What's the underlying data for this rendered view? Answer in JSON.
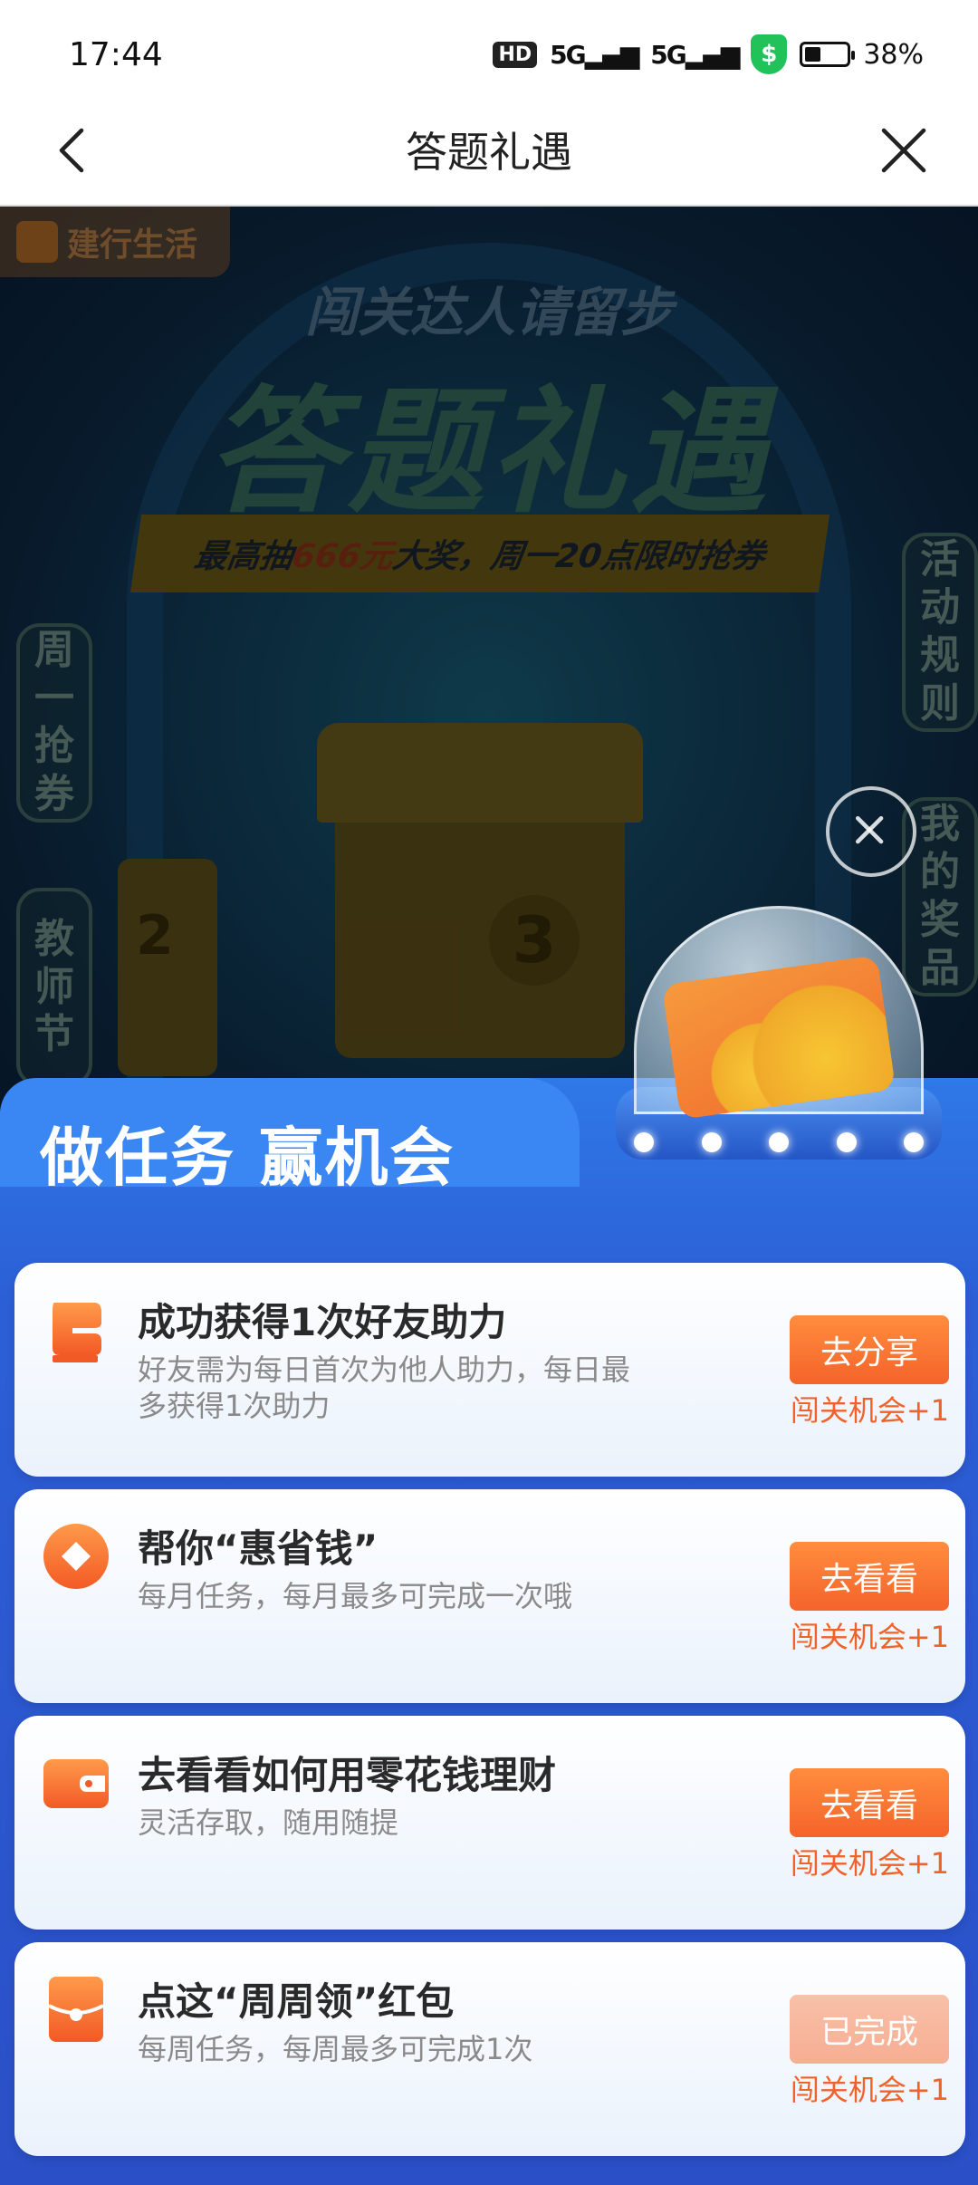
{
  "status_bar": {
    "time": "17:44",
    "hd_label": "HD",
    "signal_1": "5G",
    "signal_2": "5G",
    "battery_percent": "38%",
    "battery_level": 0.38,
    "shield_symbol": "$"
  },
  "nav": {
    "title": "答题礼遇",
    "back_icon": "chevron-left-icon",
    "close_icon": "close-icon"
  },
  "background": {
    "brand": "建行生活",
    "subtitle": "闯关达人请留步",
    "title": "答题礼遇",
    "banner_prefix": "最高抽",
    "banner_highlight": "666元",
    "banner_suffix": "大奖，周一20点限时抢券",
    "left_tabs": [
      "周一抢券",
      "教师节"
    ],
    "right_tabs": [
      "活动规则",
      "我的奖品"
    ],
    "chest_numbers": [
      "2",
      "3"
    ]
  },
  "panel": {
    "title": "做任务 赢机会",
    "tasks": [
      {
        "title": "成功获得1次好友助力",
        "desc": "好友需为每日首次为他人助力，每日最多获得1次助力",
        "button": "去分享",
        "reward": "闯关机会+1",
        "icon": "glove-icon",
        "completed": false
      },
      {
        "title": "帮你“惠省钱”",
        "desc": "每月任务，每月最多可完成一次哦",
        "button": "去看看",
        "reward": "闯关机会+1",
        "icon": "diamond-coin-icon",
        "completed": false
      },
      {
        "title": "去看看如何用零花钱理财",
        "desc": "灵活存取，随用随提",
        "button": "去看看",
        "reward": "闯关机会+1",
        "icon": "wallet-icon",
        "completed": false
      },
      {
        "title": "点这“周周领”红包",
        "desc": "每周任务，每周最多可完成1次",
        "button": "已完成",
        "reward": "闯关机会+1",
        "icon": "red-envelope-icon",
        "completed": true
      }
    ]
  },
  "colors": {
    "accent_orange": "#f5632a",
    "panel_blue": "#2c5fd6",
    "done_button": "#f6ad93"
  }
}
